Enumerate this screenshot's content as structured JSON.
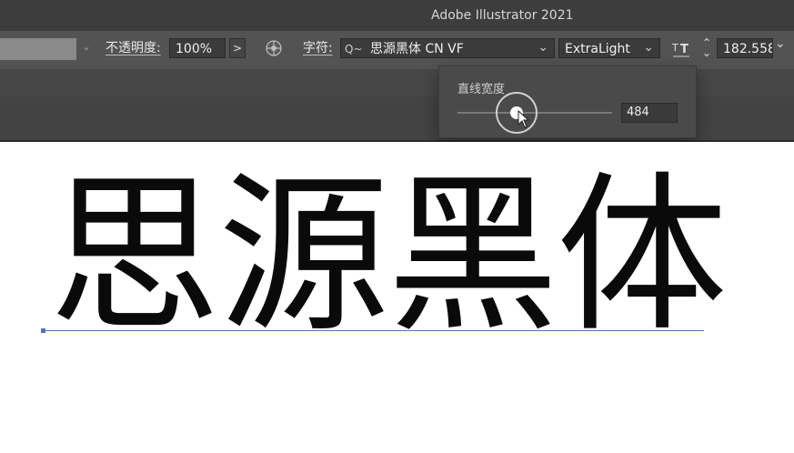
{
  "window": {
    "title": "Adobe Illustrator 2021"
  },
  "control_bar": {
    "opacity_label": "不透明度:",
    "opacity_value": "100%",
    "opacity_arrow": ">",
    "character_label": "字符:",
    "search_glyph": "Q~",
    "font_name": "思源黑体 CN VF",
    "font_style": "ExtraLight",
    "font_size": "182.558",
    "dropdown_glyph": "⌄",
    "updown_glyph": "⌃⌄"
  },
  "variable_popup": {
    "title": "直线宽度",
    "value": "484",
    "slider_fraction": 0.34
  },
  "canvas": {
    "text": "思源黑体"
  },
  "colors": {
    "ui_bg": "#535353",
    "titlebar": "#3d3d3d",
    "baseline": "#5b6fb5"
  }
}
